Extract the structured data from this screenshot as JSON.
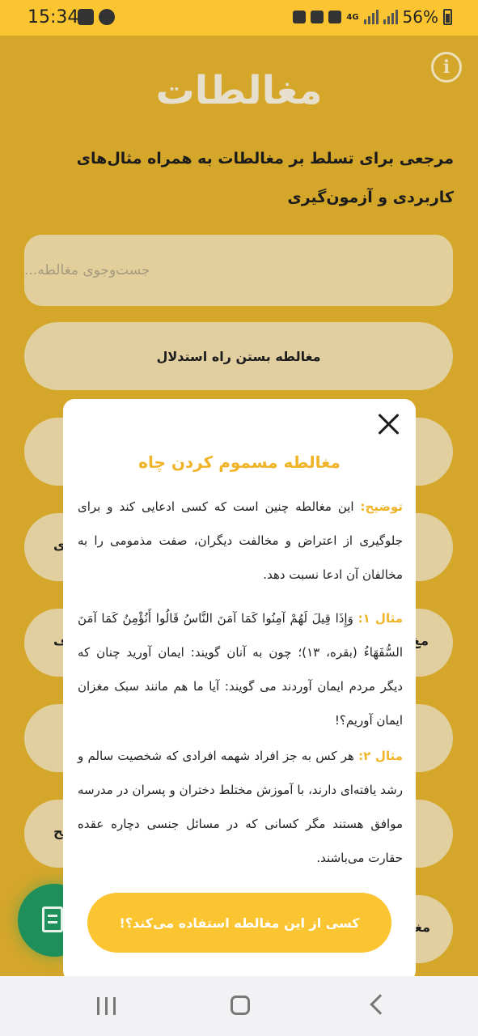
{
  "status_bar": {
    "time": "15:34",
    "network": "4G",
    "battery": "56%"
  },
  "app": {
    "logo_text": "مغالطات",
    "info_label": "i",
    "subtitle": "مرجعی برای تسلط بر مغالطات به همراه مثال‌های کاربردی و آزمون‌گیری",
    "search_placeholder": "جست‌وجوی مغالطه...",
    "first_item": "مغالطه بستن راه استدلال",
    "partial_items": [
      {
        "left": "",
        "right": ""
      },
      {
        "left": "ی",
        "right": ""
      },
      {
        "left": "ف",
        "right": "مغ"
      },
      {
        "left": "",
        "right": ""
      },
      {
        "left": "لح",
        "right": ""
      },
      {
        "left": "",
        "right": "مغا"
      }
    ]
  },
  "modal": {
    "title": "مغالطه مسموم کردن چاه",
    "explanation_label": "توضیح:",
    "explanation_text": " این مغالطه چنین است که کسی ادعایی کند و برای جلوگیری از اعتراض و مخالفت دیگران، صفت مذمومی را به مخالفان آن ادعا نسبت دهد.",
    "example1_label": "مثال ۱:",
    "example1_text": " وَإِذَا قِيلَ لَهُمْ آمِنُوا كَمَا آمَنَ النَّاسُ قَالُوا أَنُؤْمِنُ كَمَا آمَنَ السُّفَهَاءُ (بقره، ۱۳)؛ چون به آنان گویند: ایمان آورید چنان که دیگر مردم ایمان آوردند می گویند: آیا ما هم مانند سبک مغزان ایمان آوریم؟!",
    "example2_label": "مثال ۲:",
    "example2_text": " هر کس به جز افراد شهمه افرادی که شخصیت سالم و رشد یافته‌ای دارند، با آموزش مختلط دختران و پسران در مدرسه موافق هستند مگر کسانی که در مسائل جنسی دچاره عقده حقارت می‌باشند.",
    "cta_label": "کسی از این مغالطه استفاده می‌کند؟!"
  },
  "colors": {
    "accent": "#fbc531",
    "background": "#d4a62a",
    "fab": "#1e8f5a"
  }
}
